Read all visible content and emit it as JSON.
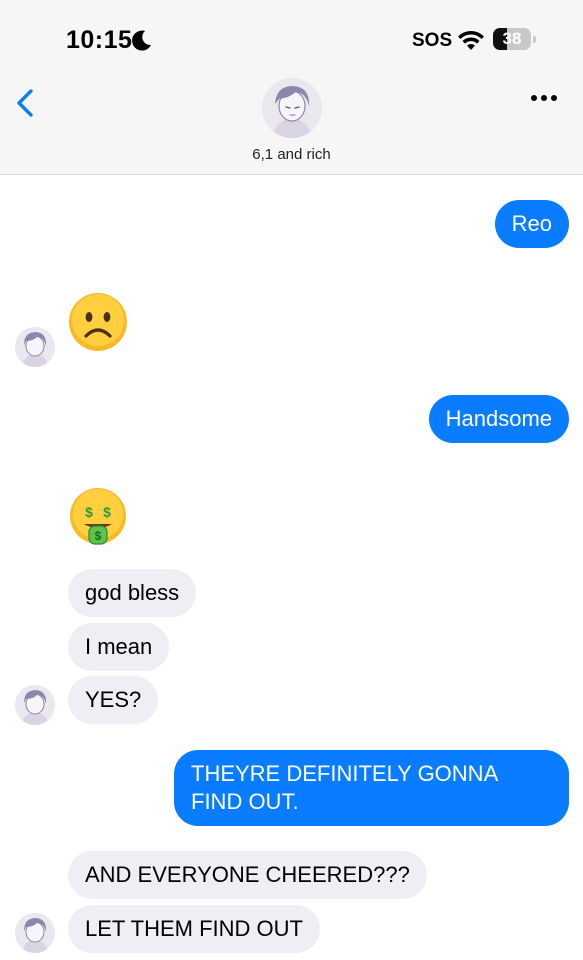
{
  "status_bar": {
    "time": "10:15",
    "sos": "SOS",
    "battery": "38",
    "battery_level": 0.38
  },
  "header": {
    "contact_name": "6,1 and rich"
  },
  "messages": [
    {
      "text": "Reo"
    },
    {
      "text": "Handsome"
    },
    {
      "text": "god bless"
    },
    {
      "text": "I mean"
    },
    {
      "text": "YES?"
    },
    {
      "text": "THEYRE DEFINITELY GONNA FIND OUT."
    },
    {
      "text": "AND EVERYONE CHEERED???"
    },
    {
      "text": "LET THEM FIND OUT"
    }
  ],
  "icons": {
    "moon": "moon-icon",
    "wifi": "wifi-icon",
    "battery": "battery-icon",
    "back": "chevron-left-icon",
    "more": "more-icon",
    "frown": "frowning-face-emoji",
    "money": "money-mouth-face-emoji"
  },
  "colors": {
    "sent_bubble": "#0a7cff",
    "received_bubble": "#efeef4",
    "accent": "#0a7cff"
  }
}
